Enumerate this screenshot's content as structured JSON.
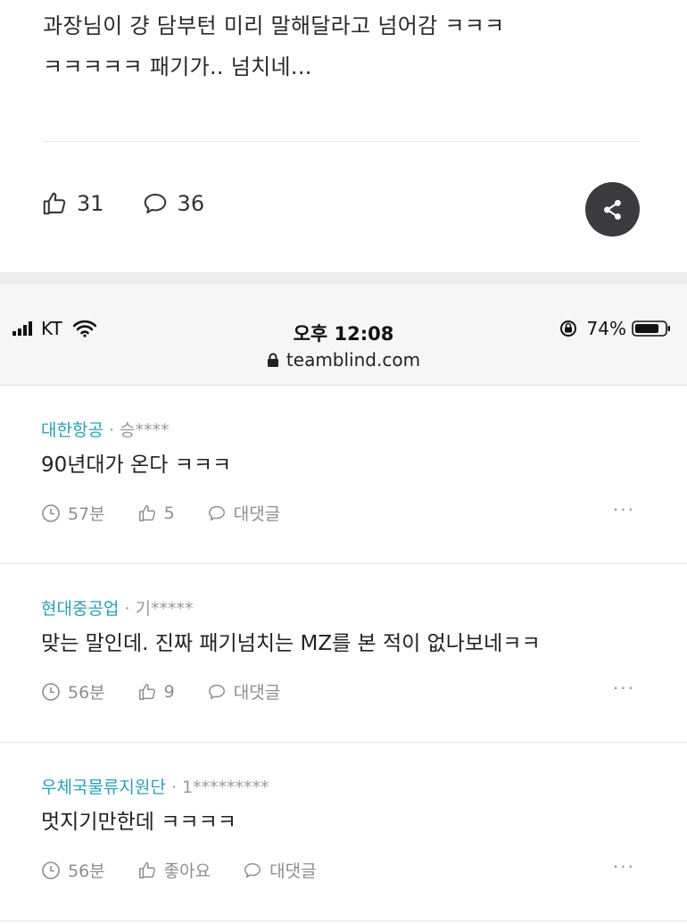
{
  "post": {
    "text_line1": "과장님이 걍 담부턴 미리 말해달라고 넘어감 ㅋㅋㅋ",
    "text_line2": "ㅋㅋㅋㅋㅋ 패기가.. 넘치네...",
    "like_count": "31",
    "comment_count": "36",
    "share_icon": "share-icon"
  },
  "statusbar": {
    "carrier": "KT",
    "time": "오후 12:08",
    "battery": "74%",
    "url": "teamblind.com"
  },
  "comments": [
    {
      "company": "대한항공",
      "user": " · 승****",
      "body": "90년대가 온다 ㅋㅋㅋ",
      "time": "57분",
      "likes": "5",
      "reply": "대댓글",
      "more": "···"
    },
    {
      "company": "현대중공업",
      "user": " · 기*****",
      "body": "맞는 말인데. 진짜 패기넘치는 MZ를 본 적이 없나보네ㅋㅋ",
      "time": "56분",
      "likes": "9",
      "reply": "대댓글",
      "more": "···"
    },
    {
      "company": "우체국물류지원단",
      "user": " · 1*********",
      "body": "멋지기만한데 ㅋㅋㅋㅋ",
      "time": "56분",
      "likes": "좋아요",
      "reply": "대댓글",
      "more": "···"
    }
  ],
  "colors": {
    "accent": "#2aa0b5",
    "share_bg": "#3b3b3f"
  }
}
